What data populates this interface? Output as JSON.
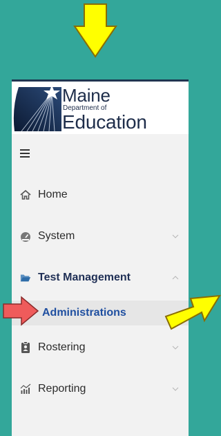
{
  "logo": {
    "line1": "Maine",
    "line2": "Department of",
    "line3": "Education"
  },
  "nav": {
    "menu_icon": "hamburger-icon",
    "items": [
      {
        "label": "Home",
        "icon": "home-icon",
        "chevron": null
      },
      {
        "label": "System",
        "icon": "gauge-icon",
        "chevron": "chevron-down-icon"
      },
      {
        "label": "Test Management",
        "icon": "folder-open-icon",
        "chevron": "chevron-up-icon",
        "active": true
      },
      {
        "label": "Rostering",
        "icon": "id-badge-icon",
        "chevron": "chevron-down-icon"
      },
      {
        "label": "Reporting",
        "icon": "bar-chart-icon",
        "chevron": "chevron-down-icon"
      }
    ],
    "subitems": [
      {
        "label": "Administrations"
      }
    ]
  },
  "annotations": {
    "arrow_color_yellow": "#ffff00",
    "arrow_color_red": "#ef5b5b",
    "arrow_outline": "#8a6d00"
  },
  "colors": {
    "background": "#33a79a",
    "panel": "#f2f2f2",
    "active_text": "#1f2f55",
    "subitem_text": "#1f4fa0"
  }
}
